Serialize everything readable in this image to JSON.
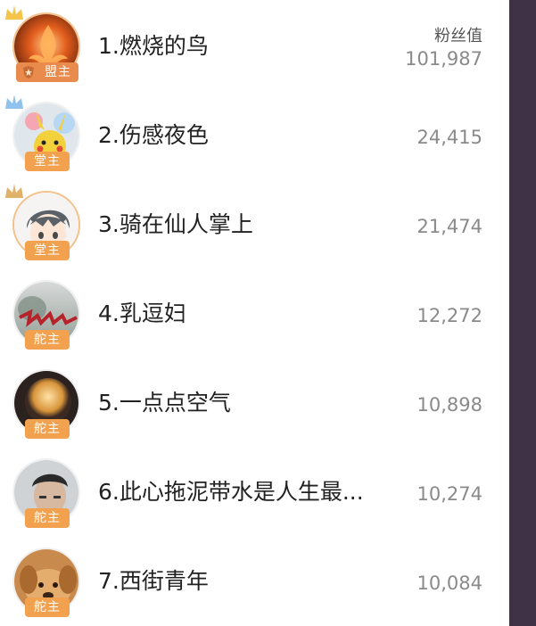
{
  "header": {
    "value_label": "粉丝值"
  },
  "rows": [
    {
      "name": "1.燃烧的鸟",
      "value": "101,987",
      "badge": "盟主",
      "crown": "gold"
    },
    {
      "name": "2.伤感夜色",
      "value": "24,415",
      "badge": "堂主",
      "crown": "blue"
    },
    {
      "name": "3.骑在仙人掌上",
      "value": "21,474",
      "badge": "堂主",
      "crown": "bronze"
    },
    {
      "name": "4.乳逗妇",
      "value": "12,272",
      "badge": "舵主"
    },
    {
      "name": "5.一点点空气",
      "value": "10,898",
      "badge": "舵主"
    },
    {
      "name": "6.此心拖泥带水是人生最...",
      "value": "10,274",
      "badge": "舵主"
    },
    {
      "name": "7.西街青年",
      "value": "10,084",
      "badge": "舵主"
    }
  ],
  "colors": {
    "sidebar": "#3f3247",
    "badge": "#f2a24f",
    "leader_badge": "#e98b4c",
    "gold_crown": "#f5c44a",
    "blue_crown": "#8fc3ee",
    "bronze_crown": "#e0b269"
  },
  "icons": {
    "crown": "crown-icon",
    "shield": "shield-icon"
  }
}
